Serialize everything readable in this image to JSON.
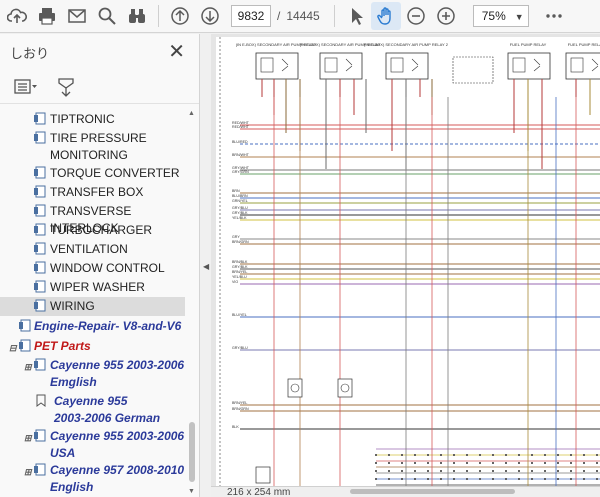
{
  "toolbar": {
    "current_page": "9832",
    "total_pages": "14445",
    "zoom": "75%"
  },
  "sidebar": {
    "title": "しおり",
    "items": [
      {
        "label": "TIPTRONIC"
      },
      {
        "label": "TIRE PRESSURE MONITORING",
        "line1": "TIRE PRESSURE",
        "line2": "MONITORING"
      },
      {
        "label": "TORQUE CONVERTER"
      },
      {
        "label": "TRANSFER BOX"
      },
      {
        "label": "TRANSVERSE INTERLOCK"
      },
      {
        "label": "TURBOCHARGER"
      },
      {
        "label": "VENTILATION"
      },
      {
        "label": "WINDOW CONTROL"
      },
      {
        "label": "WIPER WASHER"
      },
      {
        "label": "WIRING"
      },
      {
        "label": "Engine-Repair- V8-and-V6"
      },
      {
        "label": "PET Parts"
      },
      {
        "label": "Cayenne 955 2003-2006 Emglish",
        "line1": "Cayenne 955 2003-2006",
        "line2": "Emglish"
      },
      {
        "label": "Cayenne 955 2003-2006 German",
        "line1": "Cayenne 955",
        "line2": "2003-2006 German"
      },
      {
        "label": "Cayenne 955 2003-2006 USA",
        "line1": "Cayenne 955 2003-2006",
        "line2": "USA"
      },
      {
        "label": "Cayenne 957 2008-2010 English",
        "line1": "Cayenne 957 2008-2010",
        "line2": "English"
      }
    ]
  },
  "document": {
    "page_size": "216 x 254 mm",
    "relays": [
      "(IN E-BOX) SECONDARY AIR PUMP RELAY",
      "(IN E-BOX) SECONDARY AIR PUMP RELAY",
      "(IN E-BOX) SECONDARY AIR PUMP RELAY 2",
      "FUEL PUMP RELAY",
      "FUEL PUMP RELAY"
    ],
    "wire_labels": [
      "RED/WHT",
      "RED/WHT",
      "BLU/RED",
      "BRN/WHT",
      "GRY/WHT",
      "GRY/GRN",
      "BRN",
      "BLU/BRN",
      "GRN/YEL",
      "GRY/BLU",
      "GRY/BLK",
      "YEL/BLK",
      "GRY",
      "BRN/GRN",
      "BRN/BLK",
      "GRY/BLK",
      "BRN/YEL",
      "YEL/BLU",
      "VIO",
      "BLU/YEL",
      "GRY/BLU",
      "BRN/YEL",
      "BRN/GRN",
      "BLK"
    ]
  },
  "colors": {
    "accent": "#2b3a9a",
    "red_item": "#c01818",
    "selected_bg": "#dcdcdc"
  }
}
